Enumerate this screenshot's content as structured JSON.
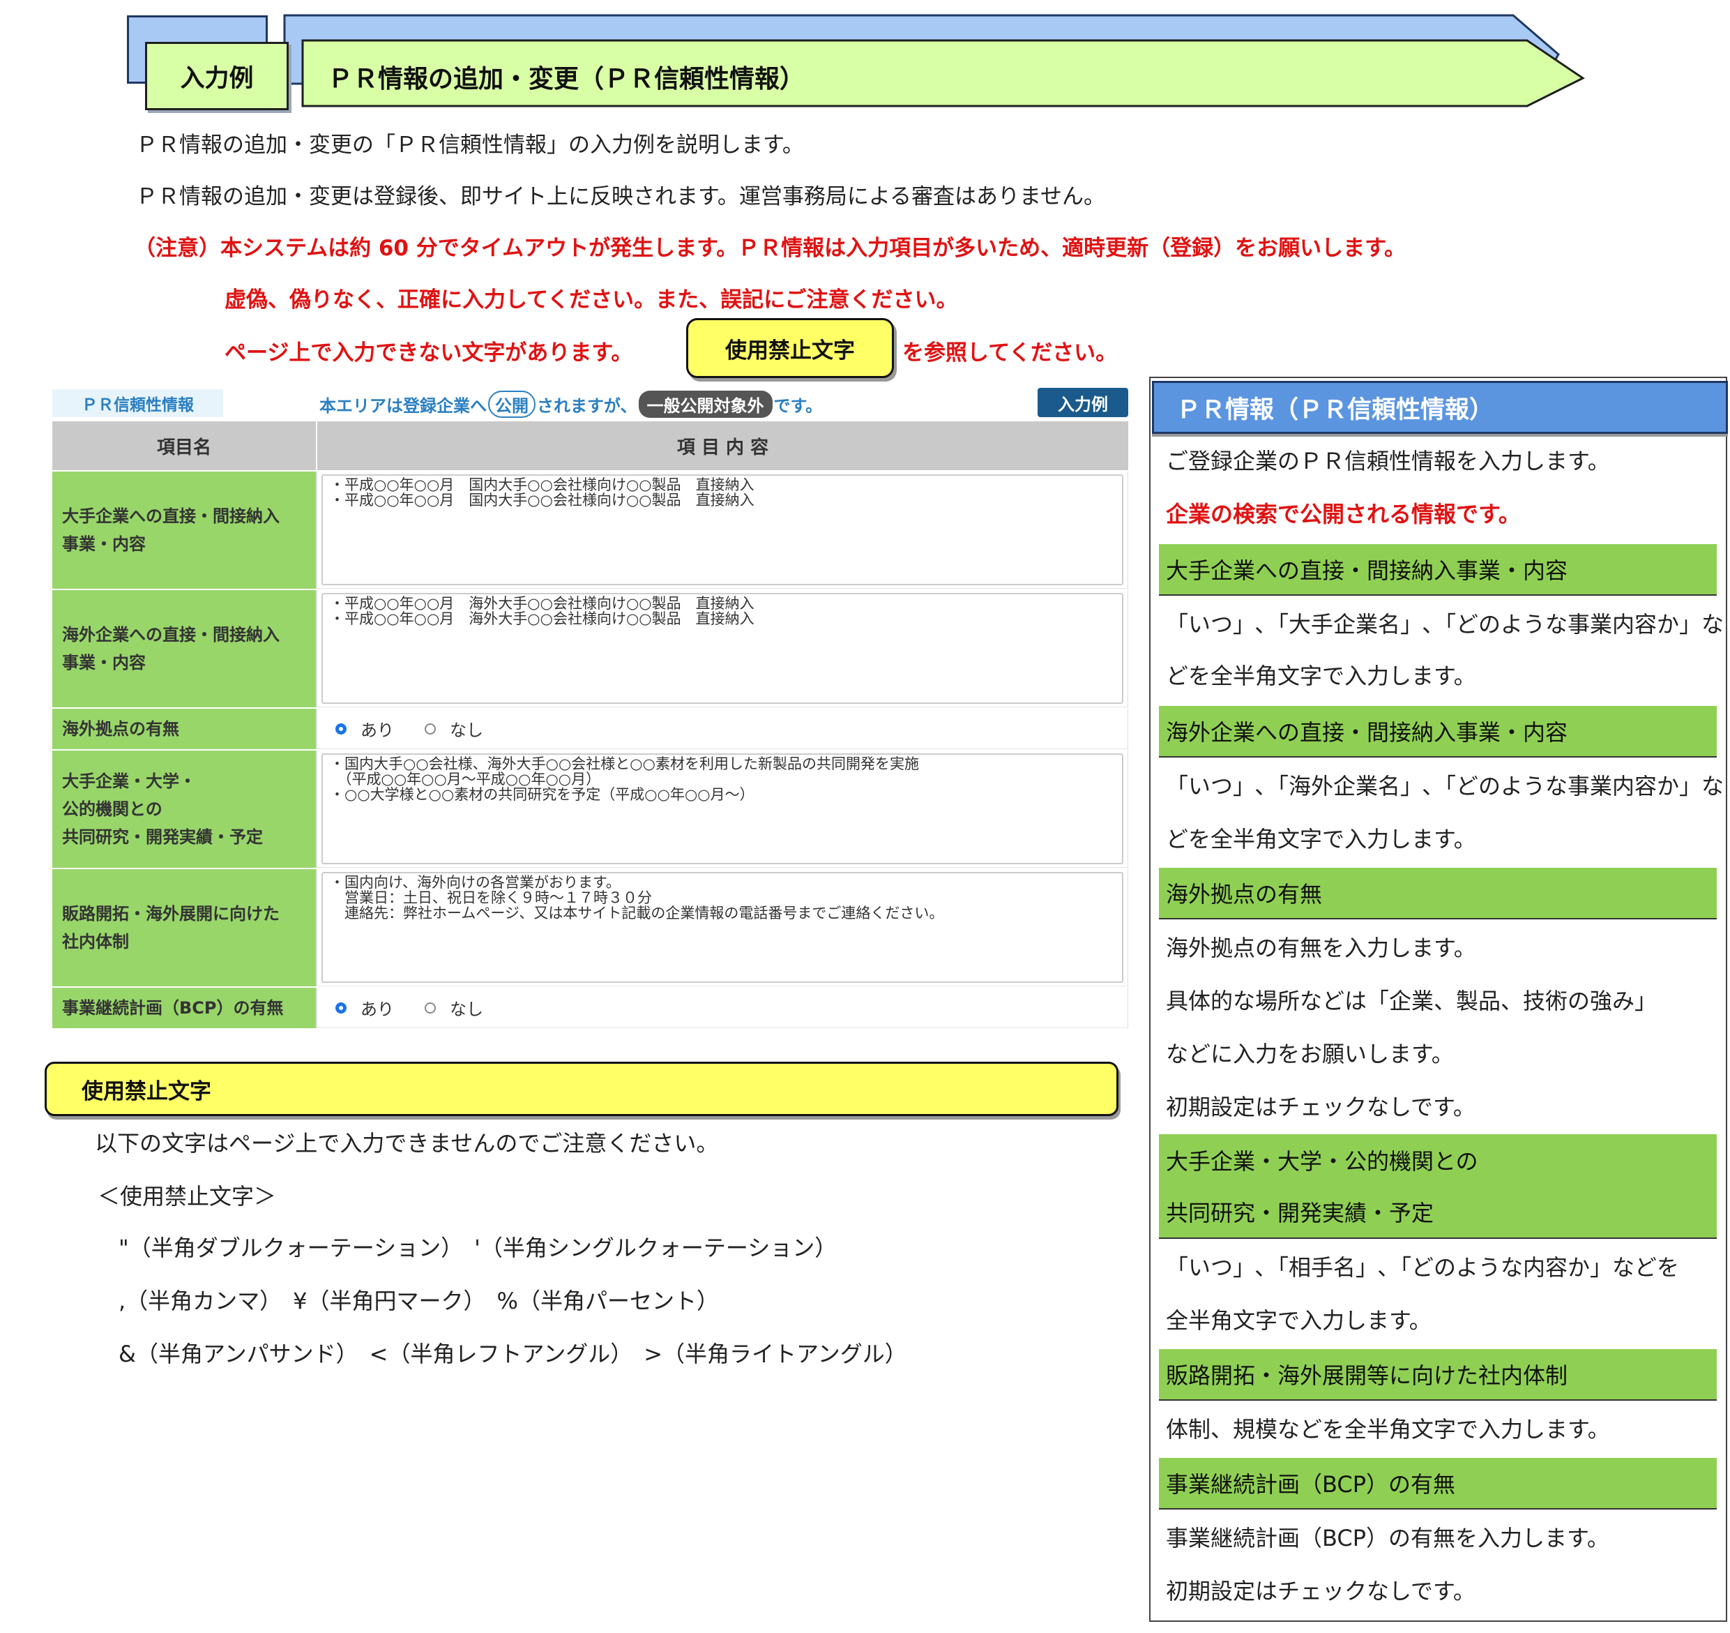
{
  "header": {
    "tag": "入力例",
    "title": "ＰＲ情報の追加・変更（ＰＲ信頼性情報）"
  },
  "intro": {
    "line1": "ＰＲ情報の追加・変更の「ＰＲ信頼性情報」の入力例を説明します。",
    "line2": "ＰＲ情報の追加・変更は登録後、即サイト上に反映されます。運営事務局による審査はありません。"
  },
  "warning": {
    "line1": "（注意）本システムは約 60 分でタイムアウトが発生します。ＰＲ情報は入力項目が多いため、適時更新（登録）をお願いします。",
    "line2": "虚偽、偽りなく、正確に入力してください。また、誤記にご注意ください。",
    "line3_before": "ページ上で入力できない文字があります。",
    "button": "使用禁止文字",
    "line3_after": "を参照してください。"
  },
  "form": {
    "section_label": "ＰＲ信頼性情報",
    "notice_before": "本エリアは登録企業へ",
    "notice_public": "公開",
    "notice_middle": "されますが、",
    "notice_badge": "一般公開対象外",
    "notice_after": "です。",
    "example_badge": "入力例",
    "col_name": "項目名",
    "col_content": "項 目 内 容",
    "rows": [
      {
        "label1": "大手企業への直接・間接納入",
        "label2": "事業・内容",
        "value": "・平成○○年○○月　国内大手○○会社様向け○○製品　直接納入\n・平成○○年○○月　国内大手○○会社様向け○○製品　直接納入"
      },
      {
        "label1": "海外企業への直接・間接納入",
        "label2": "事業・内容",
        "value": "・平成○○年○○月　海外大手○○会社様向け○○製品　直接納入\n・平成○○年○○月　海外大手○○会社様向け○○製品　直接納入"
      },
      {
        "label1": "海外拠点の有無",
        "yes": "あり",
        "no": "なし",
        "selected": "あり"
      },
      {
        "label1": "大手企業・大学・",
        "label2": "公的機関との",
        "label3": "共同研究・開発実績・予定",
        "value": "・国内大手○○会社様、海外大手○○会社様と○○素材を利用した新製品の共同開発を実施\n　（平成○○年○○月～平成○○年○○月）\n・○○大学様と○○素材の共同研究を予定（平成○○年○○月～）"
      },
      {
        "label1": "販路開拓・海外展開に向けた",
        "label2": "社内体制",
        "value": "・国内向け、海外向けの各営業がおります。\n　営業日：土日、祝日を除く９時～１７時３０分\n　連絡先：弊社ホームページ、又は本サイト記載の企業情報の電話番号までご連絡ください。"
      },
      {
        "label1": "事業継続計画（BCP）の有無",
        "yes": "あり",
        "no": "なし",
        "selected": "あり"
      }
    ]
  },
  "kinshi": {
    "title": "使用禁止文字",
    "line1": "以下の文字はページ上で入力できませんのでご注意ください。",
    "line2": "＜使用禁止文字＞",
    "line3": "\"（半角ダブルクォーテーション）　'（半角シングルクォーテーション）",
    "line4": ",（半角カンマ）　¥（半角円マーク）　%（半角パーセント）",
    "line5": "&（半角アンパサンド）　<（半角レフトアングル）　>（半角ライトアングル）"
  },
  "panel": {
    "title": "ＰＲ情報（ＰＲ信頼性情報）",
    "intro": "ご登録企業のＰＲ信頼性情報を入力します。",
    "red": "企業の検索で公開される情報です。",
    "s1_head": "大手企業への直接・間接納入事業・内容",
    "s1_l1": "「いつ」､「大手企業名」､「どのような事業内容か」な",
    "s1_l2": "どを全半角文字で入力します。",
    "s2_head": "海外企業への直接・間接納入事業・内容",
    "s2_l1": "「いつ」､「海外企業名」､「どのような事業内容か」な",
    "s2_l2": "どを全半角文字で入力します。",
    "s3_head": "海外拠点の有無",
    "s3_l1": "海外拠点の有無を入力します。",
    "s3_l2": "具体的な場所などは「企業、製品、技術の強み」",
    "s3_l3": "などに入力をお願いします。",
    "s3_l4": "初期設定はチェックなしです。",
    "s4_head1": "大手企業・大学・公的機関との",
    "s4_head2": "共同研究・開発実績・予定",
    "s4_l1": "「いつ」､「相手名」､「どのような内容か」などを",
    "s4_l2": "全半角文字で入力します。",
    "s5_head": "販路開拓・海外展開等に向けた社内体制",
    "s5_l1": "体制、規模などを全半角文字で入力します。",
    "s6_head": "事業継続計画（BCP）の有無",
    "s6_l1": "事業継続計画（BCP）の有無を入力します。",
    "s6_l2": "初期設定はチェックなしです。"
  }
}
